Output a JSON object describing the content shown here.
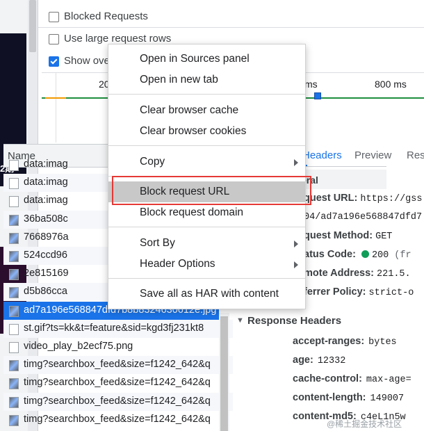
{
  "left_strip": {
    "text_fragment": "2期"
  },
  "options": {
    "blocked_requests": "Blocked Requests",
    "large_rows": "Use large request rows",
    "show_overview": "Show ove"
  },
  "timeline": {
    "labels": [
      "20",
      "ms",
      "800 ms"
    ]
  },
  "table": {
    "name_header": "Name",
    "rows": [
      {
        "name": "data:imag",
        "type": "doc"
      },
      {
        "name": "data:imag",
        "type": "doc"
      },
      {
        "name": "data:imag",
        "type": "doc"
      },
      {
        "name": "36ba508c",
        "type": "img"
      },
      {
        "name": "7668976a",
        "type": "img"
      },
      {
        "name": "524ccd96",
        "type": "img"
      },
      {
        "name": "2e815169",
        "type": "img"
      },
      {
        "name": "d5b86cca",
        "type": "img"
      },
      {
        "name": "ad7a196e568847dfd7b8b8324630612e.jpg",
        "type": "img",
        "selected": true
      },
      {
        "name": "st.gif?ts=kk&t=feature&sid=kgd3fj231kt8",
        "type": "doc"
      },
      {
        "name": "video_play_b2ecf75.png",
        "type": "doc"
      },
      {
        "name": "timg?searchbox_feed&size=f1242_642&q",
        "type": "img"
      },
      {
        "name": "timg?searchbox_feed&size=f1242_642&q",
        "type": "img"
      },
      {
        "name": "timg?searchbox_feed&size=f1242_642&q",
        "type": "img"
      },
      {
        "name": "timg?searchbox_feed&size=f1242_642&q",
        "type": "img"
      }
    ]
  },
  "right_panel": {
    "tabs": [
      "Headers",
      "Preview",
      "Resp"
    ],
    "general_title": "eral",
    "general": [
      {
        "k": "quest URL:",
        "v": "https://gss"
      },
      {
        "k": "",
        "v": "04/ad7a196e568847dfd7"
      },
      {
        "k": "quest Method:",
        "v": "GET"
      },
      {
        "k": "atus Code:",
        "v": "200",
        "suffix": "(fr"
      },
      {
        "k": "mote Address:",
        "v": "221.5."
      },
      {
        "k": "ferrer Policy:",
        "v": "strict-o"
      }
    ],
    "response_title": "Response Headers",
    "response": [
      {
        "k": "accept-ranges:",
        "v": "bytes"
      },
      {
        "k": "age:",
        "v": "12332"
      },
      {
        "k": "cache-control:",
        "v": "max-age="
      },
      {
        "k": "content-length:",
        "v": "149007"
      },
      {
        "k": "content-md5:",
        "v": "c4eL1n5w"
      }
    ]
  },
  "context_menu": {
    "items": [
      "Open in Sources panel",
      "Open in new tab",
      "Clear browser cache",
      "Clear browser cookies",
      "Copy",
      "Block request URL",
      "Block request domain",
      "Sort By",
      "Header Options",
      "Save all as HAR with content"
    ]
  },
  "watermark": "@稀土掘金技术社区",
  "colors": {
    "accent": "#1a73e8",
    "highlight_box": "#e53935",
    "status_ok": "#0f9d58"
  }
}
